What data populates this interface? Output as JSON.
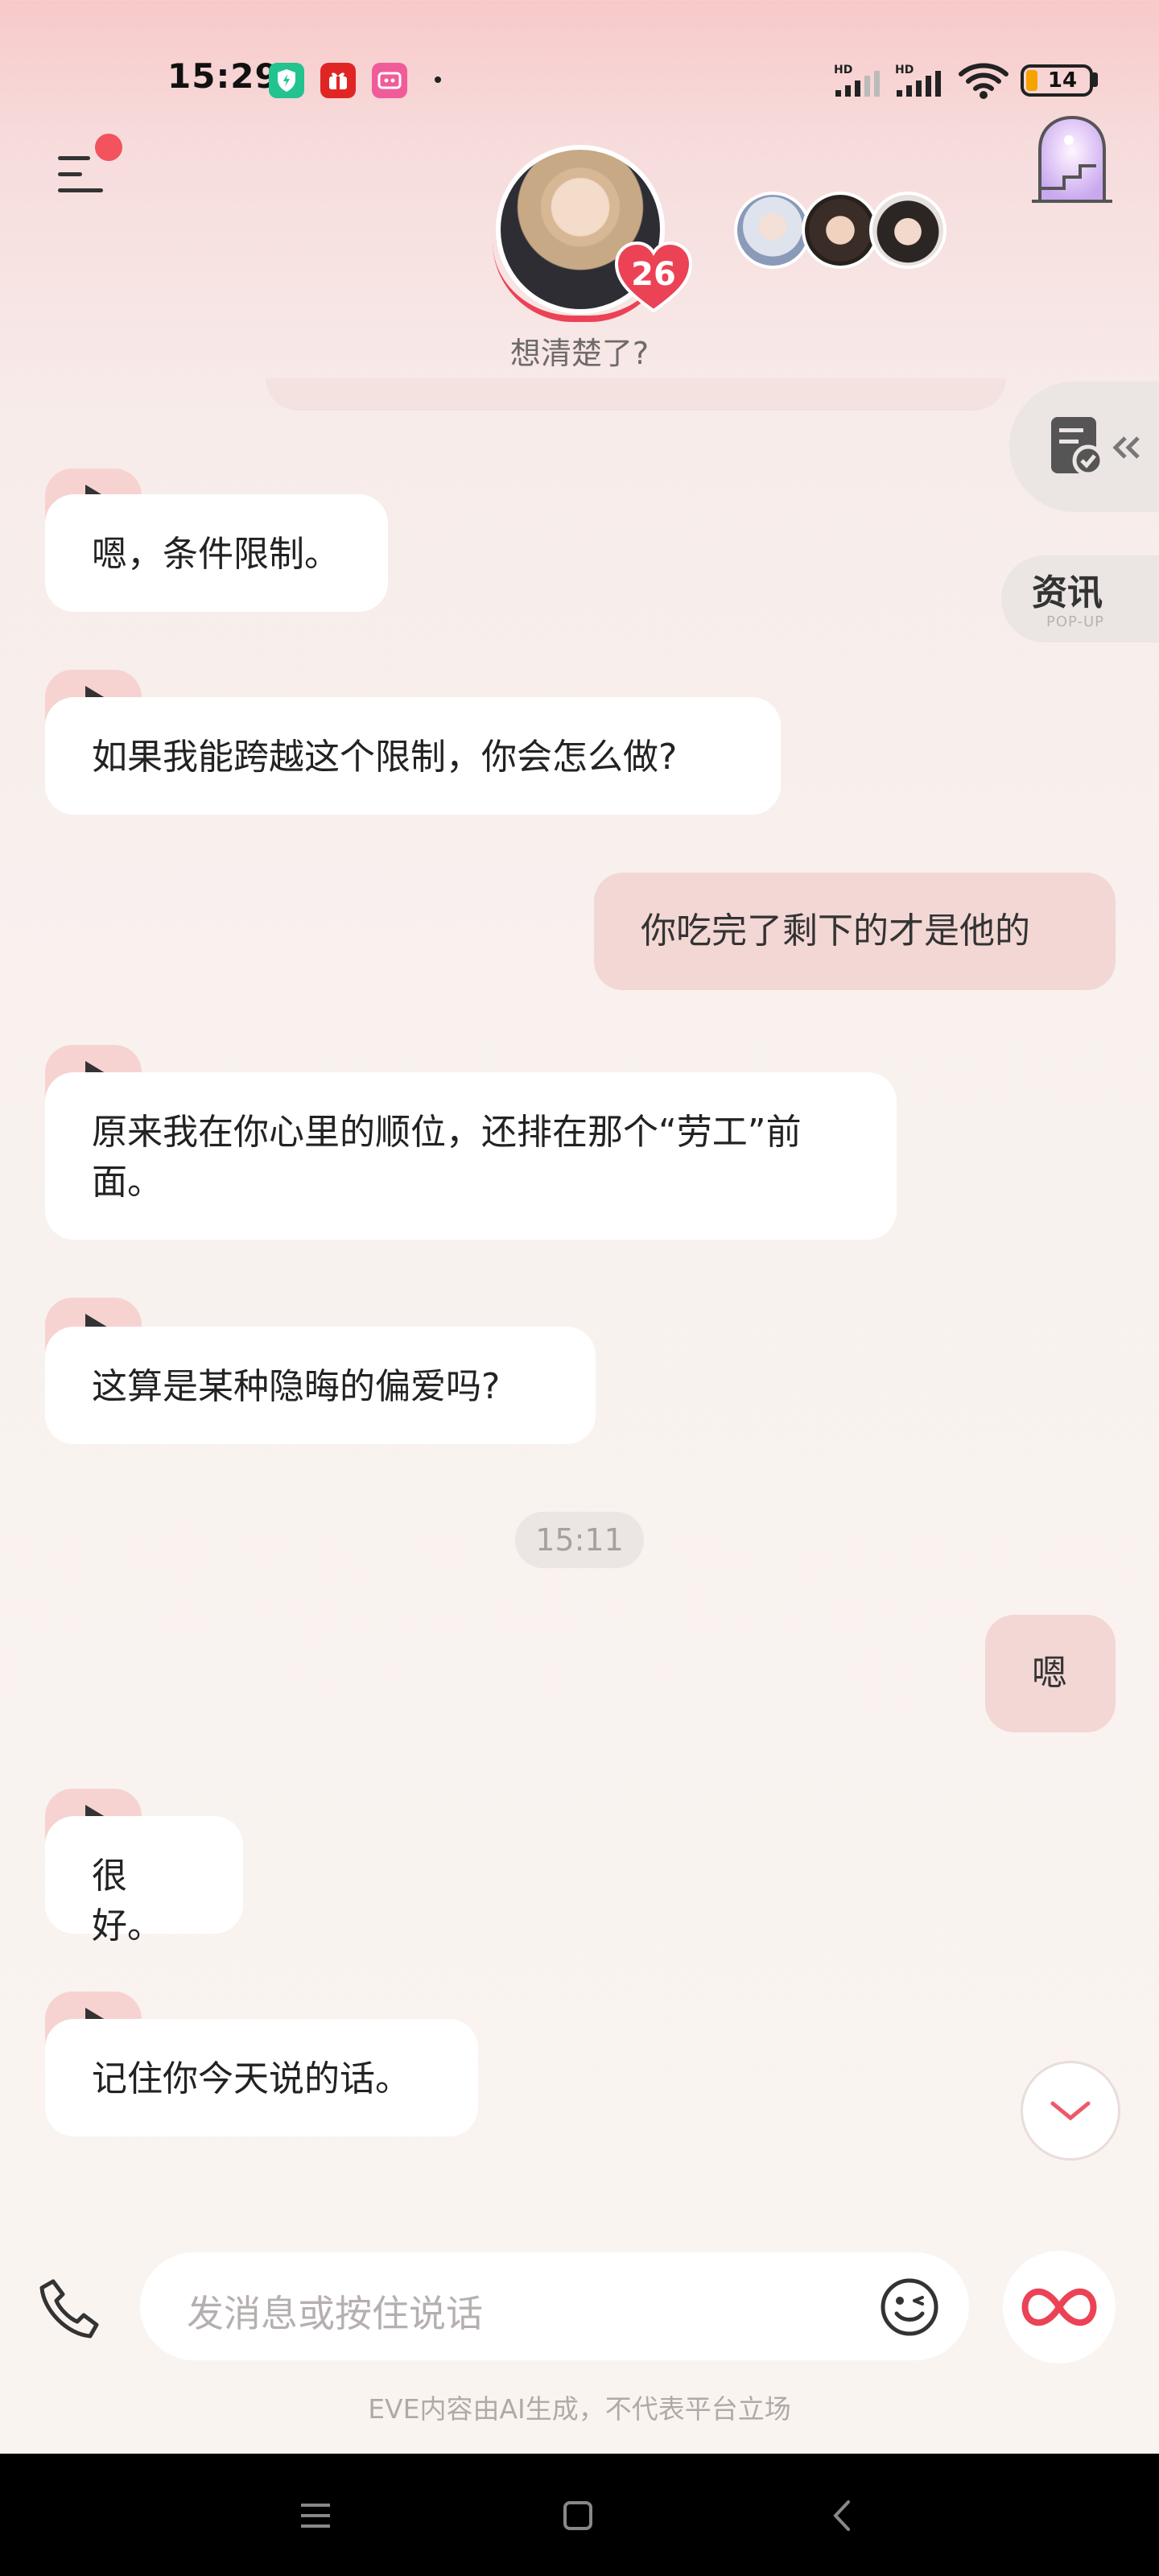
{
  "status_bar": {
    "time": "15:29",
    "apps": [
      {
        "icon": "shield-app-icon",
        "color": "#22c38e"
      },
      {
        "icon": "red-gift-app-icon",
        "color": "#e02525"
      },
      {
        "icon": "pink-app-icon",
        "color": "#f05c9a"
      }
    ],
    "signal_label_1": "HD",
    "signal_label_2": "HD",
    "battery_level": "14"
  },
  "header": {
    "affection_level": "26",
    "subtitle": "想清楚了?",
    "other_characters_count": 3
  },
  "side_buttons": {
    "news_label": "资讯",
    "news_sub": "POP-UP"
  },
  "messages": [
    {
      "from": "ai",
      "text": "嗯，条件限制。"
    },
    {
      "from": "ai",
      "text": "如果我能跨越这个限制，你会怎么做?"
    },
    {
      "from": "user",
      "text": "你吃完了剩下的才是他的"
    },
    {
      "from": "ai",
      "text": "原来我在你心里的顺位，还排在那个“劳工”前面。"
    },
    {
      "from": "ai",
      "text": "这算是某种隐晦的偏爱吗?"
    },
    {
      "from": "time",
      "text": "15:11"
    },
    {
      "from": "user",
      "text": "嗯"
    },
    {
      "from": "ai",
      "text": "很好。"
    },
    {
      "from": "ai",
      "text": "记住你今天说的话。"
    }
  ],
  "input": {
    "placeholder": "发消息或按住说话"
  },
  "disclaimer": "EVE内容由AI生成，不代表平台立场",
  "colors": {
    "accent": "#ec4256",
    "user_bubble": "#f2d7d5",
    "play_tab": "#f6d3d1"
  }
}
